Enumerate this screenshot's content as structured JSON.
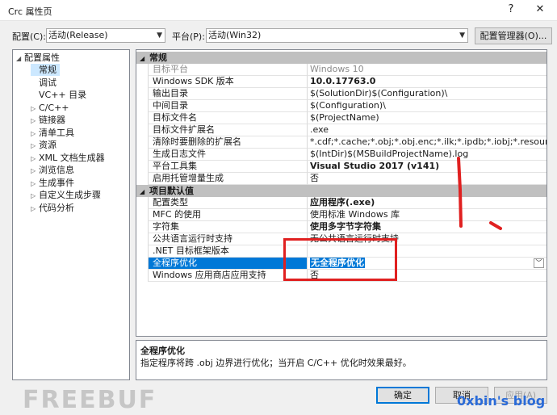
{
  "window": {
    "title": "Crc 属性页",
    "help": "?",
    "close": "✕"
  },
  "toolbar": {
    "config_label": "配置(C):",
    "config_value": "活动(Release)",
    "platform_label": "平台(P):",
    "platform_value": "活动(Win32)",
    "manager_button": "配置管理器(O)..."
  },
  "tree": {
    "items": [
      {
        "label": "配置属性",
        "expander": "◢"
      },
      {
        "label": "常规",
        "expander": ""
      },
      {
        "label": "调试",
        "expander": ""
      },
      {
        "label": "VC++ 目录",
        "expander": ""
      },
      {
        "label": "C/C++",
        "expander": "▷"
      },
      {
        "label": "链接器",
        "expander": "▷"
      },
      {
        "label": "清单工具",
        "expander": "▷"
      },
      {
        "label": "资源",
        "expander": "▷"
      },
      {
        "label": "XML 文档生成器",
        "expander": "▷"
      },
      {
        "label": "浏览信息",
        "expander": "▷"
      },
      {
        "label": "生成事件",
        "expander": "▷"
      },
      {
        "label": "自定义生成步骤",
        "expander": "▷"
      },
      {
        "label": "代码分析",
        "expander": "▷"
      }
    ]
  },
  "grid": {
    "sections": [
      {
        "title": "常规",
        "expander": "◢",
        "rows": [
          {
            "name": "目标平台",
            "value": "Windows 10"
          },
          {
            "name": "Windows SDK 版本",
            "value": "10.0.17763.0"
          },
          {
            "name": "输出目录",
            "value": "$(SolutionDir)$(Configuration)\\"
          },
          {
            "name": "中间目录",
            "value": "$(Configuration)\\"
          },
          {
            "name": "目标文件名",
            "value": "$(ProjectName)"
          },
          {
            "name": "目标文件扩展名",
            "value": ".exe"
          },
          {
            "name": "清除时要删除的扩展名",
            "value": "*.cdf;*.cache;*.obj;*.obj.enc;*.ilk;*.ipdb;*.iobj;*.resources;*.tlb;*.tli;*.t"
          },
          {
            "name": "生成日志文件",
            "value": "$(IntDir)$(MSBuildProjectName).log"
          },
          {
            "name": "平台工具集",
            "value": "Visual Studio 2017 (v141)"
          },
          {
            "name": "启用托管增量生成",
            "value": "否"
          }
        ]
      },
      {
        "title": "项目默认值",
        "expander": "◢",
        "rows": [
          {
            "name": "配置类型",
            "value": "应用程序(.exe)"
          },
          {
            "name": "MFC 的使用",
            "value": "使用标准 Windows 库"
          },
          {
            "name": "字符集",
            "value": "使用多字节字符集"
          },
          {
            "name": "公共语言运行时支持",
            "value": "无公共语言运行时支持"
          },
          {
            "name": ".NET 目标框架版本",
            "value": ""
          },
          {
            "name": "全程序优化",
            "value": "无全程序优化"
          },
          {
            "name": "Windows 应用商店应用支持",
            "value": "否"
          }
        ]
      }
    ],
    "dropdown_arrow": "﹀"
  },
  "description": {
    "heading": "全程序优化",
    "text": "指定程序将跨 .obj 边界进行优化；当开启 C/C++ 优化时效果最好。"
  },
  "buttons": {
    "ok": "确定",
    "cancel": "取消",
    "apply": "应用(A)"
  },
  "watermarks": {
    "freebuf": "FREEBUF",
    "blog": "0xbin's blog"
  },
  "colors": {
    "selection": "#0078d7",
    "annotation": "#e02020"
  }
}
